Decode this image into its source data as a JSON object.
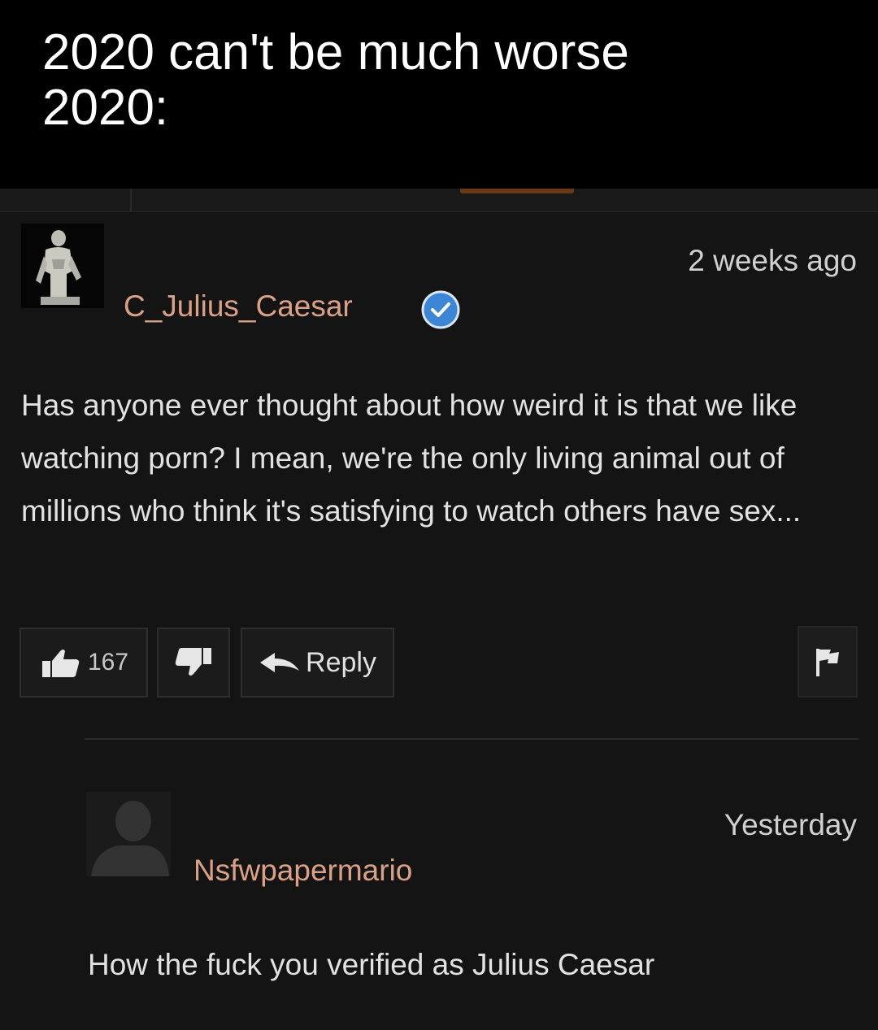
{
  "caption": {
    "line1": "2020 can't be much worse",
    "line2": "2020:"
  },
  "colors": {
    "username": "#dba186",
    "verified_badge": "#3d86d6",
    "background": "#141414",
    "caption_background": "#000000"
  },
  "comment": {
    "avatar": "statue-avatar",
    "username": "C_Julius_Caesar",
    "verified_icon": "verified-check-icon",
    "timestamp": "2 weeks ago",
    "body": "Has anyone ever thought about how weird it is that we like watching porn? I mean, we're the only living animal out of millions who think it's satisfying to watch others have sex...",
    "actions": {
      "like_icon": "thumbs-up-icon",
      "like_count": "167",
      "dislike_icon": "thumbs-down-icon",
      "reply_icon": "reply-arrow-icon",
      "reply_label": "Reply",
      "flag_icon": "flag-icon"
    }
  },
  "reply": {
    "avatar": "default-user-silhouette",
    "username": "Nsfwpapermario",
    "timestamp": "Yesterday",
    "body": "How the fuck you verified as Julius Caesar"
  }
}
